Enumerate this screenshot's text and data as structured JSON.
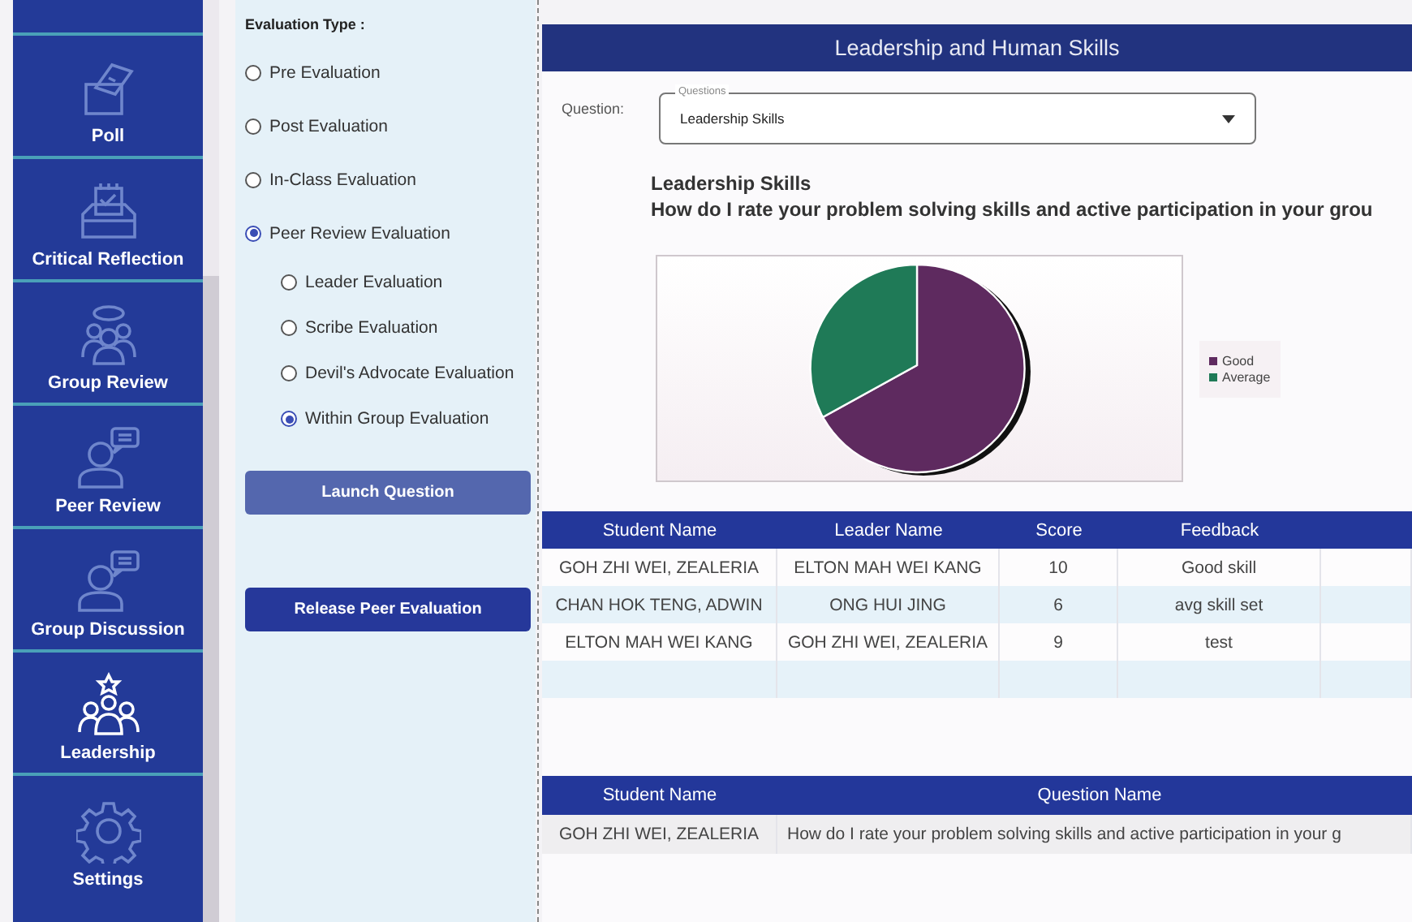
{
  "sidebar": {
    "items": [
      {
        "label": "Poll",
        "kind": "poll",
        "selected": false
      },
      {
        "label": "Critical Reflection",
        "kind": "reflection",
        "selected": false
      },
      {
        "label": "Group Review",
        "kind": "group",
        "selected": false
      },
      {
        "label": "Peer Review",
        "kind": "peer",
        "selected": false
      },
      {
        "label": "Group Discussion",
        "kind": "peer",
        "selected": false
      },
      {
        "label": "Leadership",
        "kind": "leader",
        "selected": true
      },
      {
        "label": "Settings",
        "kind": "gear",
        "selected": false
      }
    ]
  },
  "evaluation": {
    "title": "Evaluation Type :",
    "options": [
      {
        "label": "Pre Evaluation",
        "selected": false
      },
      {
        "label": "Post Evaluation",
        "selected": false
      },
      {
        "label": "In-Class Evaluation",
        "selected": false
      },
      {
        "label": "Peer Review Evaluation",
        "selected": true,
        "children": [
          {
            "label": "Leader Evaluation",
            "selected": false
          },
          {
            "label": "Scribe Evaluation",
            "selected": false
          },
          {
            "label": "Devil's Advocate Evaluation",
            "selected": false
          },
          {
            "label": "Within Group Evaluation",
            "selected": true
          }
        ]
      }
    ],
    "buttons": [
      {
        "label": "Launch Question",
        "hovered": true
      },
      {
        "label": "Release Peer Evaluation",
        "hovered": false
      }
    ]
  },
  "main": {
    "title": "Leadership and Human Skills",
    "question_label": "Question:",
    "question_select": {
      "label": "Questions",
      "value": "Leadership Skills"
    },
    "heading": "Leadership Skills",
    "question_text": "How do I rate your problem solving skills and active participation in your grou",
    "legend": [
      {
        "label": "Good",
        "color": "#5e2a5f"
      },
      {
        "label": "Average",
        "color": "#1f7a57"
      }
    ],
    "scores_table": {
      "columns": [
        "Student Name",
        "Leader Name",
        "Score",
        "Feedback"
      ],
      "rows": [
        [
          "GOH ZHI WEI, ZEALERIA",
          "ELTON MAH WEI KANG",
          "10",
          "Good skill"
        ],
        [
          "CHAN HOK TENG, ADWIN",
          "ONG HUI JING",
          "6",
          "avg skill set"
        ],
        [
          "ELTON MAH WEI KANG",
          "GOH ZHI WEI, ZEALERIA",
          "9",
          "test"
        ],
        [
          "",
          "",
          "",
          ""
        ]
      ]
    },
    "questions_table": {
      "columns": [
        "Student Name",
        "Question Name"
      ],
      "rows": [
        [
          "GOH ZHI WEI, ZEALERIA",
          "How do I rate your problem solving skills and active participation in your g"
        ]
      ]
    }
  }
}
